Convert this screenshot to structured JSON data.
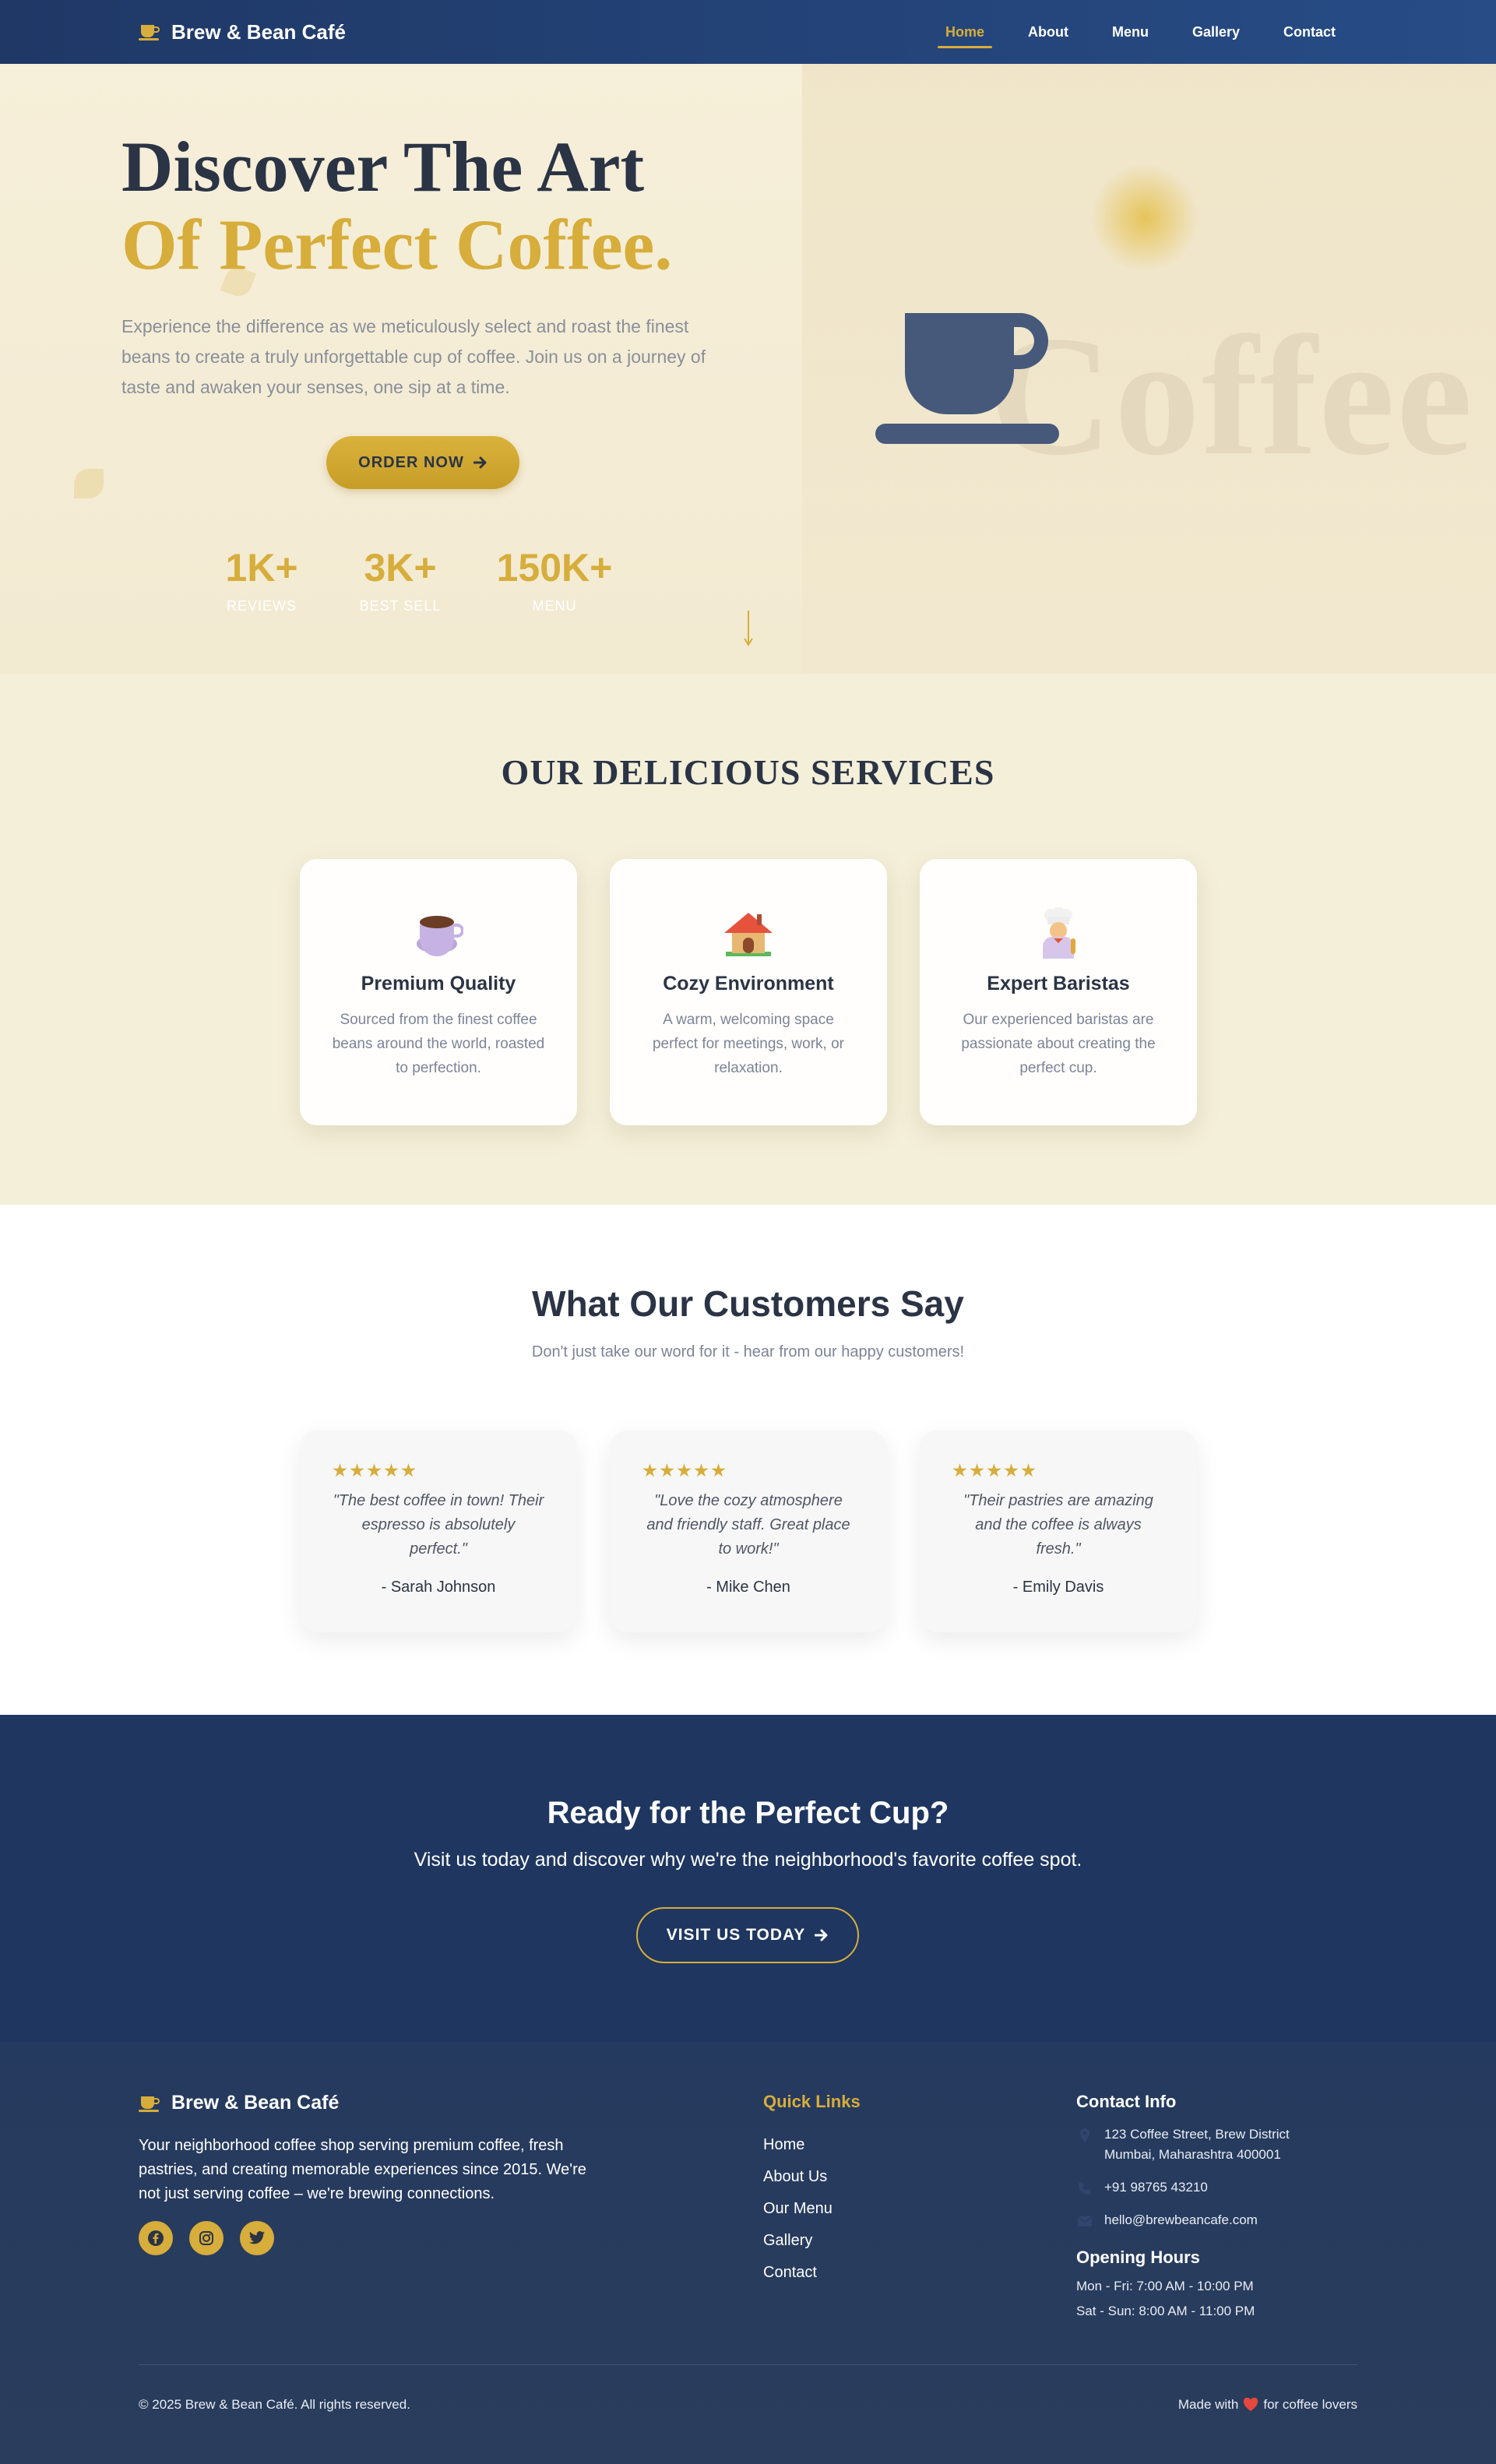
{
  "nav": {
    "brand": "Brew & Bean Café",
    "links": [
      "Home",
      "About",
      "Menu",
      "Gallery",
      "Contact"
    ],
    "active": "Home"
  },
  "hero": {
    "title_line1": "Discover The Art",
    "title_line2": "Of Perfect Coffee.",
    "subtitle": "Experience the difference as we meticulously select and roast the finest beans to create a truly unforgettable cup of coffee. Join us on a journey of taste and awaken your senses, one sip at a time.",
    "order_button": "ORDER NOW",
    "stats": [
      {
        "value": "1K+",
        "label": "REVIEWS"
      },
      {
        "value": "3K+",
        "label": "BEST SELL"
      },
      {
        "value": "150K+",
        "label": "MENU"
      }
    ],
    "background_word": "Coffee"
  },
  "services": {
    "title": "OUR DELICIOUS SERVICES",
    "cards": [
      {
        "title": "Premium Quality",
        "text": "Sourced from the finest coffee beans around the world, roasted to perfection.",
        "icon": "coffee-cup-icon"
      },
      {
        "title": "Cozy Environment",
        "text": "A warm, welcoming space perfect for meetings, work, or relaxation.",
        "icon": "house-icon"
      },
      {
        "title": "Expert Baristas",
        "text": "Our experienced baristas are passionate about creating the perfect cup.",
        "icon": "chef-icon"
      }
    ]
  },
  "testimonials": {
    "title": "What Our Customers Say",
    "subtitle": "Don't just take our word for it - hear from our happy customers!",
    "items": [
      {
        "quote": "\"The best coffee in town! Their espresso is absolutely perfect.\"",
        "author": "- Sarah Johnson",
        "rating": 5
      },
      {
        "quote": "\"Love the cozy atmosphere and friendly staff. Great place to work!\"",
        "author": "- Mike Chen",
        "rating": 5
      },
      {
        "quote": "\"Their pastries are amazing and the coffee is always fresh.\"",
        "author": "- Emily Davis",
        "rating": 5
      }
    ]
  },
  "cta": {
    "title": "Ready for the Perfect Cup?",
    "text": "Visit us today and discover why we're the neighborhood's favorite coffee spot.",
    "button": "VISIT US TODAY"
  },
  "footer": {
    "brand": "Brew & Bean Café",
    "description": "Your neighborhood coffee shop serving premium coffee, fresh pastries, and creating memorable experiences since 2015. We're not just serving coffee – we're brewing connections.",
    "quick_links_title": "Quick Links",
    "quick_links": [
      "Home",
      "About Us",
      "Our Menu",
      "Gallery",
      "Contact"
    ],
    "contact_title": "Contact Info",
    "address_line1": "123 Coffee Street, Brew District",
    "address_line2": "Mumbai, Maharashtra 400001",
    "phone": "+91 98765 43210",
    "email": "hello@brewbeancafe.com",
    "hours_title": "Opening Hours",
    "hours": [
      "Mon - Fri: 7:00 AM - 10:00 PM",
      "Sat - Sun: 8:00 AM - 11:00 PM"
    ],
    "copyright": "© 2025 Brew & Bean Café. All rights reserved.",
    "made_with_prefix": "Made with",
    "made_with_suffix": "for coffee lovers"
  },
  "colors": {
    "navy": "#1f3866",
    "gold": "#d7ad3b",
    "cream": "#f4efd9",
    "text_dark": "#2b3445"
  }
}
